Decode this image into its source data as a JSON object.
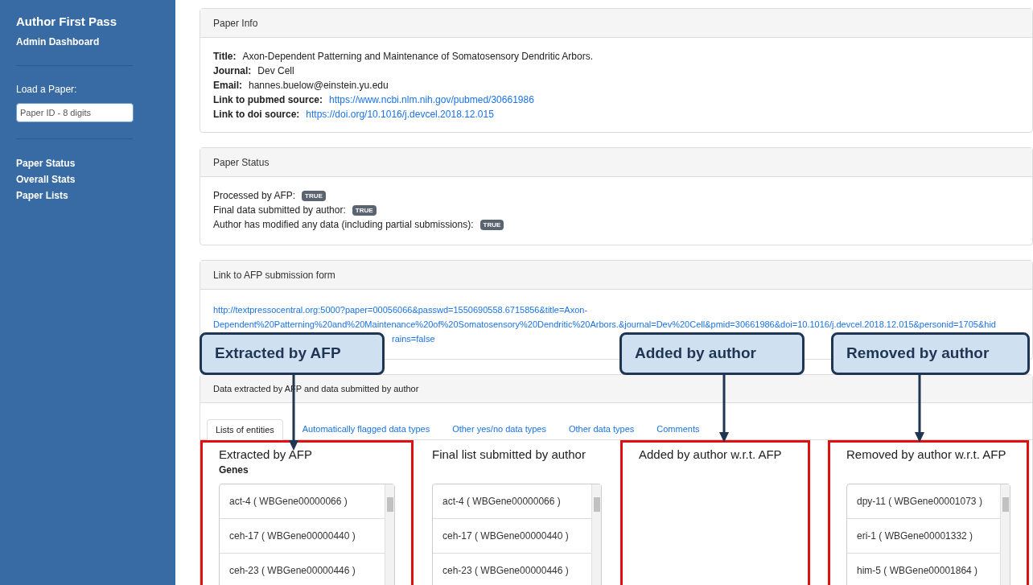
{
  "sidebar": {
    "title": "Author First Pass",
    "subtitle": "Admin Dashboard",
    "load_label": "Load a Paper:",
    "paper_id_field": {
      "placeholder": "Paper ID - 8 digits"
    },
    "nav_items": [
      "Paper Status",
      "Overall Stats",
      "Paper Lists"
    ]
  },
  "paper_info": {
    "header": "Paper Info",
    "fields": [
      {
        "label": "Title:",
        "value": "Axon-Dependent Patterning and Maintenance of Somatosensory Dendritic Arbors.",
        "kind": "text"
      },
      {
        "label": "Journal:",
        "value": "Dev Cell",
        "kind": "text"
      },
      {
        "label": "Email:",
        "value": "hannes.buelow@einstein.yu.edu",
        "kind": "text"
      },
      {
        "label": "Link to pubmed source:",
        "value": "https://www.ncbi.nlm.nih.gov/pubmed/30661986",
        "kind": "link"
      },
      {
        "label": "Link to doi source:",
        "value": "https://doi.org/10.1016/j.devcel.2018.12.015",
        "kind": "link"
      }
    ]
  },
  "paper_status": {
    "header": "Paper Status",
    "items": [
      {
        "label": "Processed by AFP:",
        "badge": "TRUE"
      },
      {
        "label": "Final data submitted by author:",
        "badge": "TRUE"
      },
      {
        "label": "Author has modified any data (including partial submissions):",
        "badge": "TRUE"
      }
    ]
  },
  "submission_link": {
    "header": "Link to AFP submission form",
    "url_lines": [
      "http://textpressocentral.org:5000?paper=00056066&passwd=1550690558.6715856&title=Axon-",
      "Dependent%20Patterning%20and%20Maintenance%20of%20Somatosensory%20Dendritic%20Arbors.&journal=Dev%20Cell&pmid=30661986&doi=10.1016/j.devcel.2018.12.015&personid=1705&hid",
      "rains=false"
    ]
  },
  "data_panel": {
    "header": "Data extracted by AFP and data submitted by author",
    "tabs": [
      {
        "label": "Lists of entities",
        "selected": true
      },
      {
        "label": "Automatically flagged data types",
        "selected": false
      },
      {
        "label": "Other yes/no data types",
        "selected": false
      },
      {
        "label": "Other data types",
        "selected": false
      },
      {
        "label": "Comments",
        "selected": false
      }
    ],
    "columns": [
      {
        "title": "Extracted by AFP",
        "subtitle": "Genes",
        "highlighted": true,
        "items": [
          "act-4 ( WBGene00000066 )",
          "ceh-17 ( WBGene00000440 )",
          "ceh-23 ( WBGene00000446 )"
        ]
      },
      {
        "title": "Final list submitted by author",
        "highlighted": false,
        "items": [
          "act-4 ( WBGene00000066 )",
          "ceh-17 ( WBGene00000440 )",
          "ceh-23 ( WBGene00000446 )"
        ]
      },
      {
        "title": "Added by author w.r.t. AFP",
        "highlighted": true
      },
      {
        "title": "Removed by author w.r.t. AFP",
        "highlighted": true,
        "items": [
          "dpy-11 ( WBGene00001073 )",
          "eri-1 ( WBGene00001332 )",
          "him-5 ( WBGene00001864 )"
        ]
      }
    ]
  },
  "callouts": [
    "Extracted by AFP",
    "Added by author",
    "Removed by author"
  ]
}
